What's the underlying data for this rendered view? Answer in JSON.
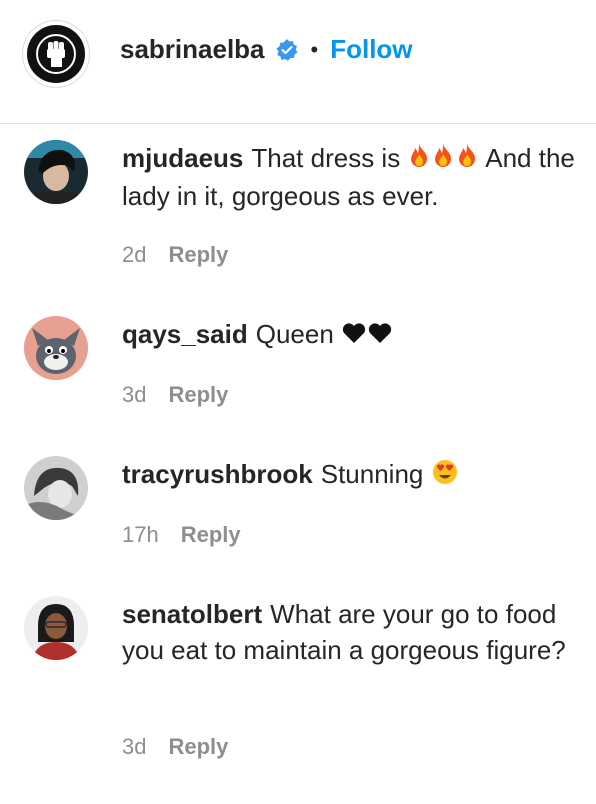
{
  "header": {
    "username": "sabrinaelba",
    "separator": "•",
    "follow_label": "Follow"
  },
  "colors": {
    "follow_blue": "#0095f6",
    "verified_blue": "#3897f0",
    "meta_gray": "#8e8e8e",
    "text": "#262626"
  },
  "comments": [
    {
      "username": "mjudaeus",
      "text": "That dress is",
      "emoji_icons": [
        "fire-icon",
        "fire-icon",
        "fire-icon"
      ],
      "text_after": "And the lady in it, gorgeous as ever.",
      "time": "2d",
      "reply_label": "Reply"
    },
    {
      "username": "qays_said",
      "text": "Queen",
      "emoji_icons": [
        "black-heart-icon",
        "black-heart-icon"
      ],
      "time": "3d",
      "reply_label": "Reply"
    },
    {
      "username": "tracyrushbrook",
      "text": "Stunning",
      "emoji_icons": [
        "heart-eyes-icon"
      ],
      "time": "17h",
      "reply_label": "Reply"
    },
    {
      "username": "senatolbert",
      "text": "What are your go to food you eat to maintain a gorgeous figure?",
      "time": "3d",
      "reply_label": "Reply"
    }
  ]
}
